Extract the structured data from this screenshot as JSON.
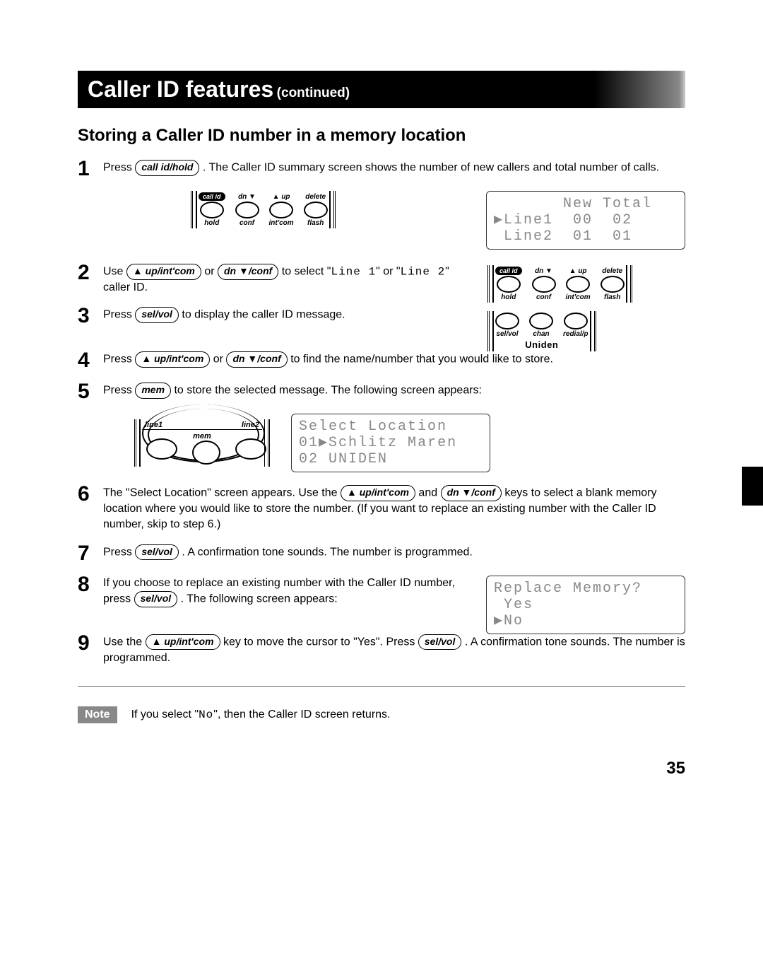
{
  "banner": {
    "title": "Caller ID features",
    "cont": "(continued)"
  },
  "section_title": "Storing a Caller ID number in a memory location",
  "buttons": {
    "call_id_hold": "call id/hold",
    "up_intcom": "▲ up/int'com",
    "dn_conf": "dn ▼/conf",
    "sel_vol": "sel/vol",
    "mem": "mem"
  },
  "steps": {
    "s1a": "Press ",
    "s1b": ". The Caller ID summary screen shows the number of new callers and total number of calls.",
    "s2a": "Use ",
    "s2b": " or ",
    "s2c": " to select \"",
    "s2line1": "Line 1",
    "s2d": "\" or \"",
    "s2line2": "Line 2",
    "s2e": "\" caller ID.",
    "s3a": "Press ",
    "s3b": " to display the caller ID message.",
    "s4a": "Press ",
    "s4b": " or ",
    "s4c": " to find the name/number that you would like to store.",
    "s5a": "Press ",
    "s5b": " to store the selected message. The following screen appears:",
    "s6a": "The \"Select Location\" screen appears. Use the ",
    "s6b": " and ",
    "s6c": " keys to select a blank memory location where you would like to store the number. (If you want to replace an existing number with the Caller ID number, skip to step 6.)",
    "s7a": "Press ",
    "s7b": ". A confirmation tone sounds. The number is programmed.",
    "s8a": "If you choose to replace an existing number with the Caller ID number, press ",
    "s8b": ". The following screen appears:",
    "s9a": "Use the ",
    "s9b": " key to move the cursor to \"Yes\". Press ",
    "s9c": ". A confirmation tone sounds. The number is programmed."
  },
  "keypad_top": {
    "labels_top": [
      "call id",
      "dn ▼",
      "▲ up",
      "delete"
    ],
    "labels_bot": [
      "hold",
      "conf",
      "int'com",
      "flash"
    ]
  },
  "keypad_bottom": {
    "labels_bot": [
      "sel/vol",
      "chan",
      "redial/p"
    ],
    "brand": "Uniden"
  },
  "keypad_mem": {
    "line1": "line1",
    "line2": "line2",
    "mem": "mem"
  },
  "lcd1": "       New Total\n▶Line1  00  02\n Line2  01  01",
  "lcd2": "Select Location\n01▶Schlitz Maren\n02 UNIDEN",
  "lcd3": "Replace Memory?\n Yes\n▶No",
  "note": {
    "tag": "Note",
    "text_a": "If you select \"",
    "no": "No",
    "text_b": "\", then the Caller ID screen returns."
  },
  "page_number": "35"
}
